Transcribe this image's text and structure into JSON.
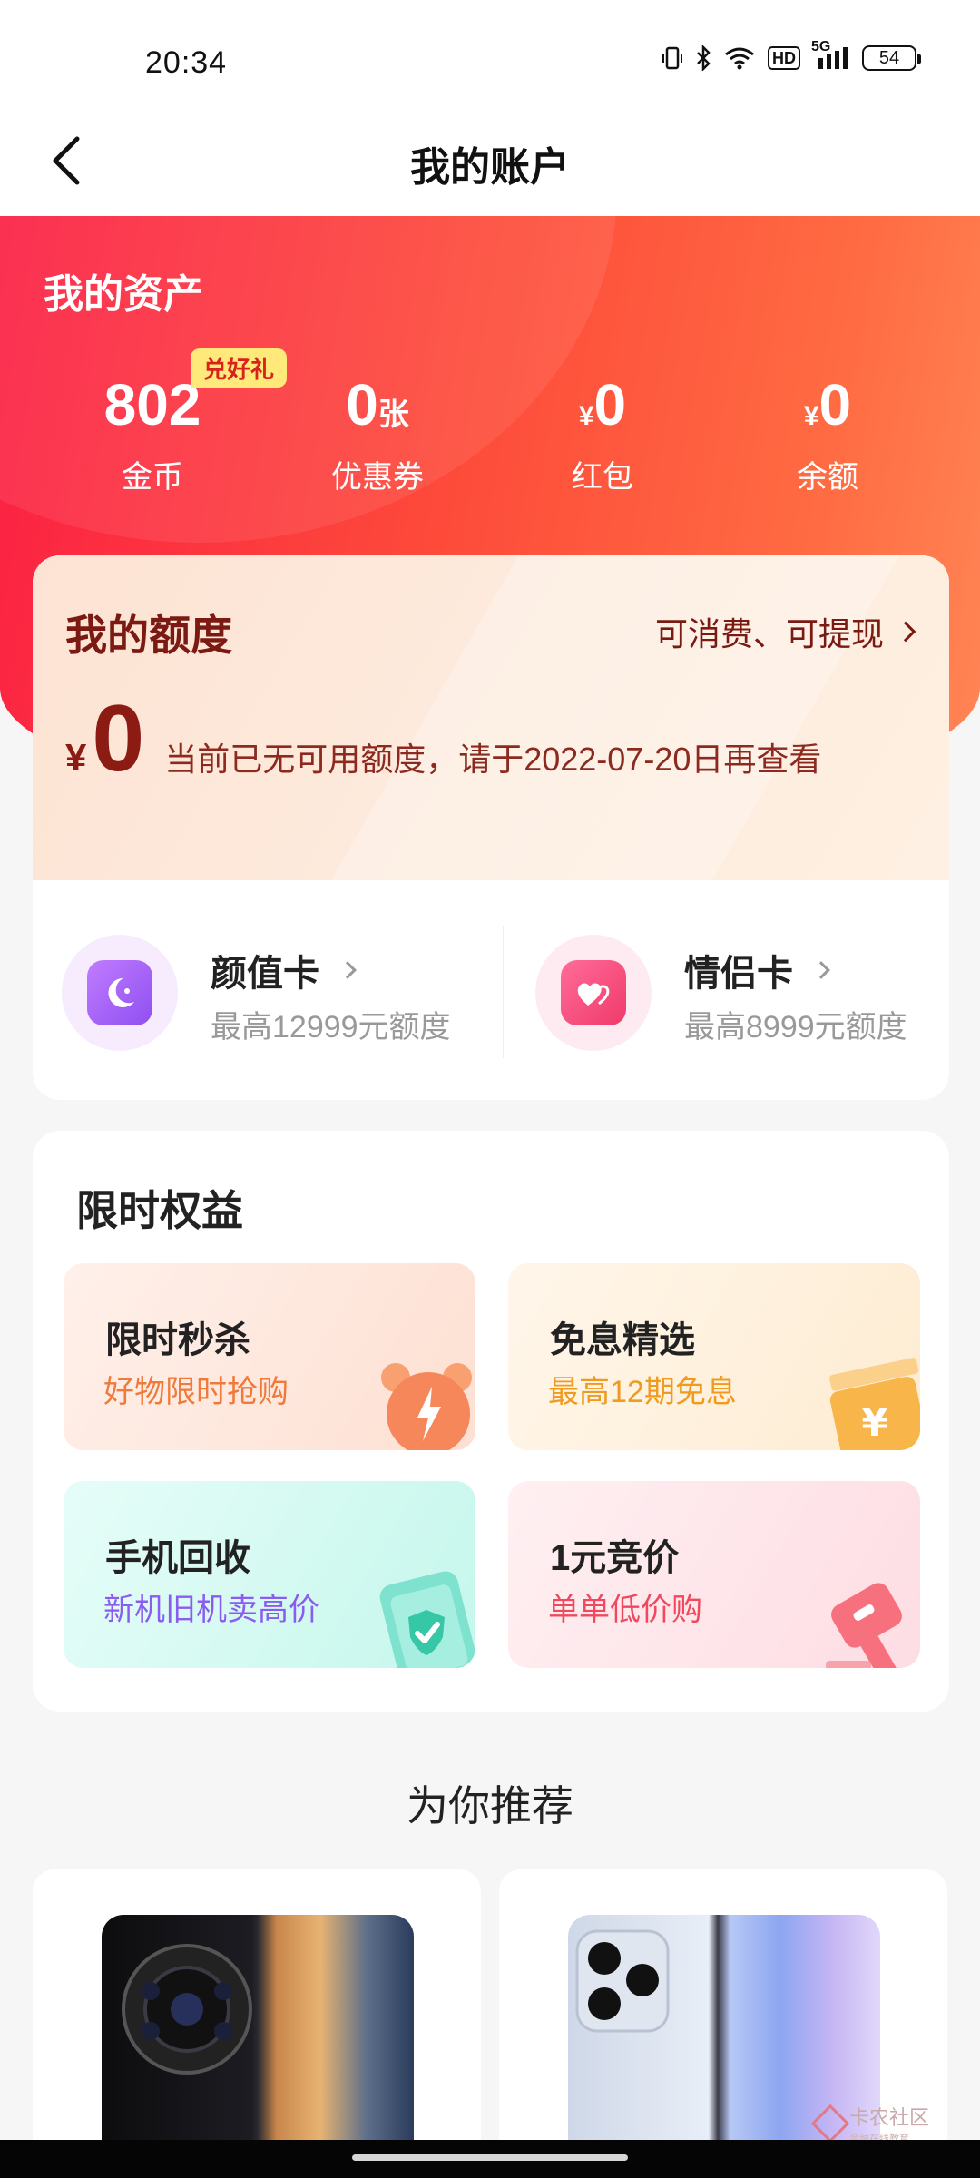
{
  "status_bar": {
    "time": "20:34",
    "icons": [
      "vibrate-icon",
      "bluetooth-icon",
      "wifi-icon",
      "hd-icon",
      "signal-5g-icon",
      "battery-icon"
    ],
    "hd_label": "HD",
    "network_label": "5G",
    "battery": "54"
  },
  "nav": {
    "title": "我的账户",
    "back_icon": "back-arrow-icon"
  },
  "assets": {
    "title": "我的资产",
    "badge": "兑好礼",
    "items": [
      {
        "value": "802",
        "currency": "",
        "unit": "",
        "label": "金币"
      },
      {
        "value": "0",
        "currency": "",
        "unit": "张",
        "label": "优惠券"
      },
      {
        "value": "0",
        "currency": "¥",
        "unit": "",
        "label": "红包"
      },
      {
        "value": "0",
        "currency": "¥",
        "unit": "",
        "label": "余额"
      }
    ]
  },
  "quota": {
    "title": "我的额度",
    "link": "可消费、可提现",
    "currency": "¥",
    "amount": "0",
    "note": "当前已无可用额度，请于2022-07-20日再查看"
  },
  "cards": [
    {
      "name": "颜值卡",
      "desc": "最高12999元额度",
      "icon": "face-card-icon",
      "color": "#a45cf2"
    },
    {
      "name": "情侣卡",
      "desc": "最高8999元额度",
      "icon": "heart-card-icon",
      "color": "#f24c7c"
    }
  ],
  "benefits": {
    "title": "限时权益",
    "tiles": [
      {
        "title": "限时秒杀",
        "subtitle": "好物限时抢购",
        "icon": "alarm-clock-icon",
        "accent": "#f07a3a"
      },
      {
        "title": "免息精选",
        "subtitle": "最高12期免息",
        "icon": "yuan-coin-icon",
        "accent": "#f09a1f"
      },
      {
        "title": "手机回收",
        "subtitle": "新机旧机卖高价",
        "icon": "shield-phone-icon",
        "accent": "#8a5cf0"
      },
      {
        "title": "1元竞价",
        "subtitle": "单单低价购",
        "icon": "auction-hammer-icon",
        "accent": "#f0485e"
      }
    ]
  },
  "recommend": {
    "title": "为你推荐"
  },
  "watermark": {
    "text": "卡农社区",
    "sub": "金融在线教育"
  }
}
